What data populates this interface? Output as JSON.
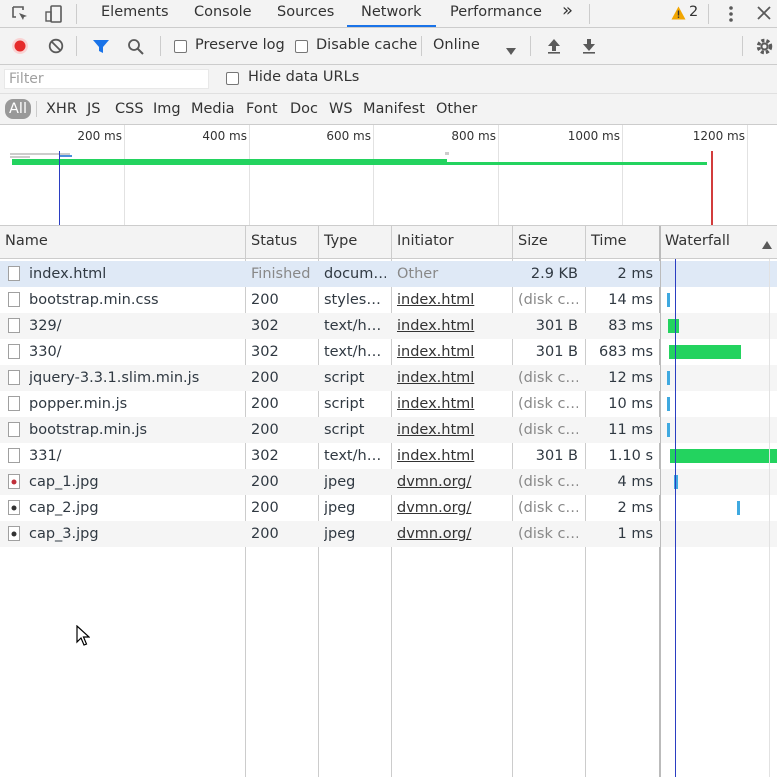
{
  "tabs": [
    "Elements",
    "Console",
    "Sources",
    "Network",
    "Performance"
  ],
  "active_tab": "Network",
  "more_tabs_label": "»",
  "warning_count": "2",
  "toolbar": {
    "preserve_log": "Preserve log",
    "disable_cache": "Disable cache",
    "throttling": "Online"
  },
  "filter": {
    "placeholder": "Filter",
    "hide_data_urls": "Hide data URLs"
  },
  "types": [
    "All",
    "XHR",
    "JS",
    "CSS",
    "Img",
    "Media",
    "Font",
    "Doc",
    "WS",
    "Manifest",
    "Other"
  ],
  "active_type": "All",
  "overview_ticks": [
    "200 ms",
    "400 ms",
    "600 ms",
    "800 ms",
    "1000 ms",
    "1200 ms"
  ],
  "columns": [
    "Name",
    "Status",
    "Type",
    "Initiator",
    "Size",
    "Time",
    "Waterfall"
  ],
  "rows": [
    {
      "name": "index.html",
      "status": "Finished",
      "type": "docum…",
      "initiator": "Other",
      "size": "2.9 KB",
      "time": "2 ms",
      "icon": "document-icon"
    },
    {
      "name": "bootstrap.min.css",
      "status": "200",
      "type": "styles…",
      "initiator": "index.html",
      "size": "(disk c…",
      "time": "14 ms",
      "icon": "document-icon"
    },
    {
      "name": "329/",
      "status": "302",
      "type": "text/h…",
      "initiator": "index.html",
      "size": "301 B",
      "time": "83 ms",
      "icon": "document-icon"
    },
    {
      "name": "330/",
      "status": "302",
      "type": "text/h…",
      "initiator": "index.html",
      "size": "301 B",
      "time": "683 ms",
      "icon": "document-icon"
    },
    {
      "name": "jquery-3.3.1.slim.min.js",
      "status": "200",
      "type": "script",
      "initiator": "index.html",
      "size": "(disk c…",
      "time": "12 ms",
      "icon": "document-icon"
    },
    {
      "name": "popper.min.js",
      "status": "200",
      "type": "script",
      "initiator": "index.html",
      "size": "(disk c…",
      "time": "10 ms",
      "icon": "document-icon"
    },
    {
      "name": "bootstrap.min.js",
      "status": "200",
      "type": "script",
      "initiator": "index.html",
      "size": "(disk c…",
      "time": "11 ms",
      "icon": "document-icon"
    },
    {
      "name": "331/",
      "status": "302",
      "type": "text/h…",
      "initiator": "index.html",
      "size": "301 B",
      "time": "1.10 s",
      "icon": "document-icon"
    },
    {
      "name": "cap_1.jpg",
      "status": "200",
      "type": "jpeg",
      "initiator": "dvmn.org/",
      "size": "(disk c…",
      "time": "4 ms",
      "icon": "image-icon"
    },
    {
      "name": "cap_2.jpg",
      "status": "200",
      "type": "jpeg",
      "initiator": "dvmn.org/",
      "size": "(disk c…",
      "time": "2 ms",
      "icon": "image-icon"
    },
    {
      "name": "cap_3.jpg",
      "status": "200",
      "type": "jpeg",
      "initiator": "dvmn.org/",
      "size": "(disk c…",
      "time": "1 ms",
      "icon": "image-icon"
    }
  ],
  "colors": {
    "accent": "#1a73e8",
    "bar": "#23d35f",
    "record": "#e52b2b",
    "selected_row": "#dfe9f6"
  }
}
